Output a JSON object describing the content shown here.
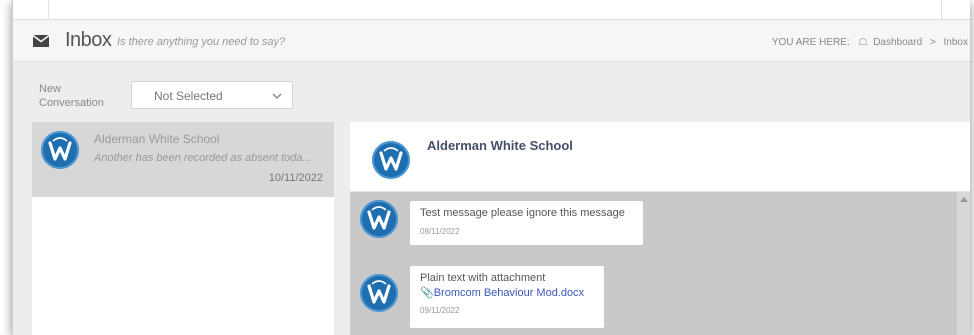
{
  "header": {
    "title": "Inbox",
    "subtitle": "Is there anything you need to say?",
    "breadcrumb": {
      "prefix": "YOU ARE HERE:",
      "home_icon": "home-icon",
      "items": [
        "Dashboard",
        "Inbox"
      ],
      "separator": ">"
    }
  },
  "new_conversation": {
    "label": "New Conversation",
    "selected": "Not Selected"
  },
  "conversations": [
    {
      "name": "Alderman White School",
      "preview": "Another has been recorded as absent toda...",
      "date": "10/11/2022"
    }
  ],
  "chat": {
    "title": "Alderman White School",
    "messages": [
      {
        "text": "Test message please ignore this message",
        "date": "08/11/2022"
      },
      {
        "text": "Plain text with attachment",
        "attachment": "Bromcom Behaviour Mod.docx",
        "date": "09/11/2022"
      }
    ]
  },
  "colors": {
    "avatar_blue": "#1f6fb0",
    "link_blue": "#3b57b8",
    "selected_item_bg": "#d7d7d7",
    "messages_bg": "#c9c9c9",
    "chat_title": "#44506b"
  }
}
